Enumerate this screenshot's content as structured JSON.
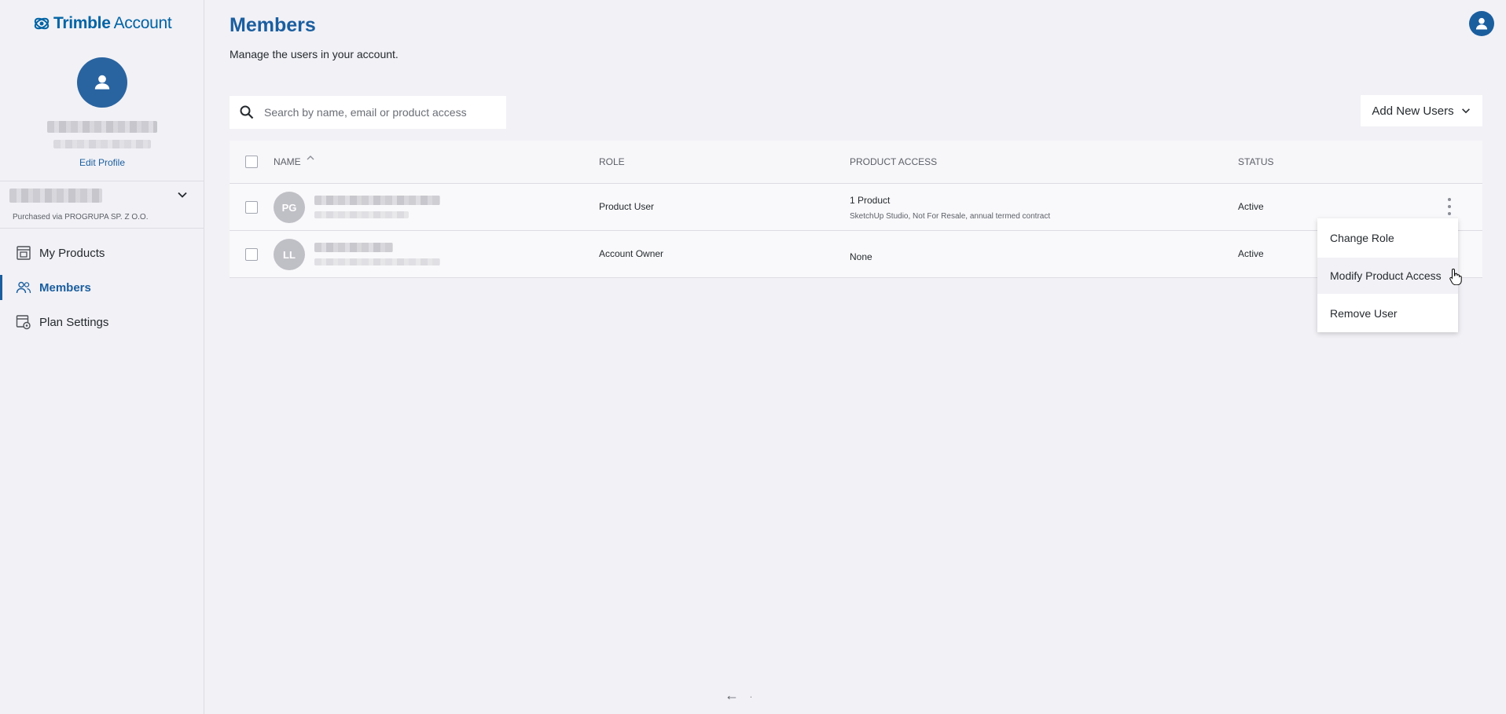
{
  "brand": {
    "name_bold": "Trimble",
    "name_light": "Account"
  },
  "profile": {
    "edit_label": "Edit Profile"
  },
  "org": {
    "purchased_via": "Purchased via PROGRUPA SP. Z O.O."
  },
  "nav": {
    "items": [
      {
        "label": "My Products",
        "icon": "window-box-icon"
      },
      {
        "label": "Members",
        "icon": "people-icon",
        "active": true
      },
      {
        "label": "Plan Settings",
        "icon": "window-gear-icon"
      }
    ]
  },
  "header": {
    "title": "Members",
    "subtitle": "Manage the users in your account."
  },
  "search": {
    "placeholder": "Search by name, email or product access"
  },
  "actions": {
    "add_users_label": "Add New Users"
  },
  "table": {
    "columns": {
      "name": "NAME",
      "role": "ROLE",
      "product_access": "PRODUCT ACCESS",
      "status": "STATUS"
    },
    "rows": [
      {
        "initials": "PG",
        "role": "Product User",
        "product_access": "1 Product",
        "product_detail": "SketchUp Studio, Not For Resale, annual termed contract",
        "status": "Active"
      },
      {
        "initials": "LL",
        "role": "Account Owner",
        "product_access": "None",
        "product_detail": "",
        "status": "Active"
      }
    ]
  },
  "context_menu": {
    "items": [
      "Change Role",
      "Modify Product Access",
      "Remove User"
    ]
  },
  "pager": {
    "prev_symbol": "←",
    "indicator": "."
  },
  "colors": {
    "accent": "#1b5e9e",
    "background": "#f1f1f6"
  }
}
